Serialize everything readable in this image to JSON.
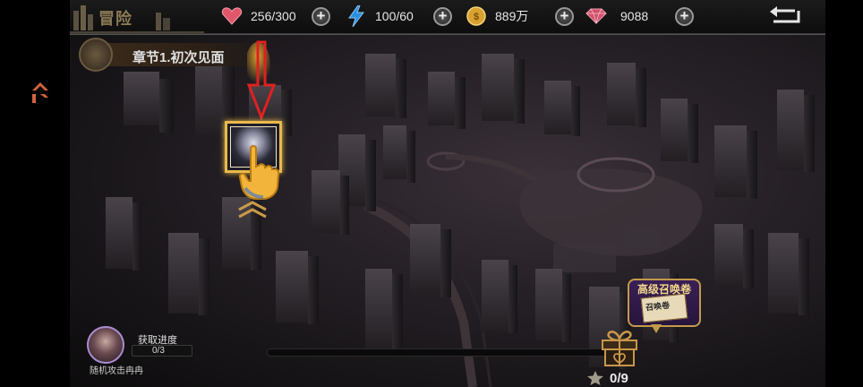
{
  "app": {
    "logo_text": "冒险"
  },
  "resources": [
    {
      "id": "stamina",
      "icon": "heart-gem-icon",
      "value": "256/300",
      "color": "#e0566a"
    },
    {
      "id": "energy",
      "icon": "lightning-icon",
      "value": "100/60",
      "color": "#2a8fe0"
    },
    {
      "id": "gold",
      "icon": "gold-coin-icon",
      "value": "889万",
      "color": "#d9a230"
    },
    {
      "id": "diamond",
      "icon": "diamond-icon",
      "value": "9088",
      "color": "#d0506a"
    }
  ],
  "plus_label": "+",
  "chapter": {
    "title": "章节1.初次见面"
  },
  "mission": {
    "progress_label": "获取进度",
    "progress_value": "0/3",
    "progress_fraction": 0,
    "subtitle": "随机攻击冉冉"
  },
  "stars": {
    "value": "0/9",
    "icon": "star-icon"
  },
  "track_progress": 0,
  "ticket": {
    "title": "高级召唤卷",
    "card_text": "召唤卷"
  },
  "colors": {
    "accent_gold": "#e9b94a",
    "tutorial_arrow": "#e02020",
    "ticket_purple": "#3a1f57"
  }
}
